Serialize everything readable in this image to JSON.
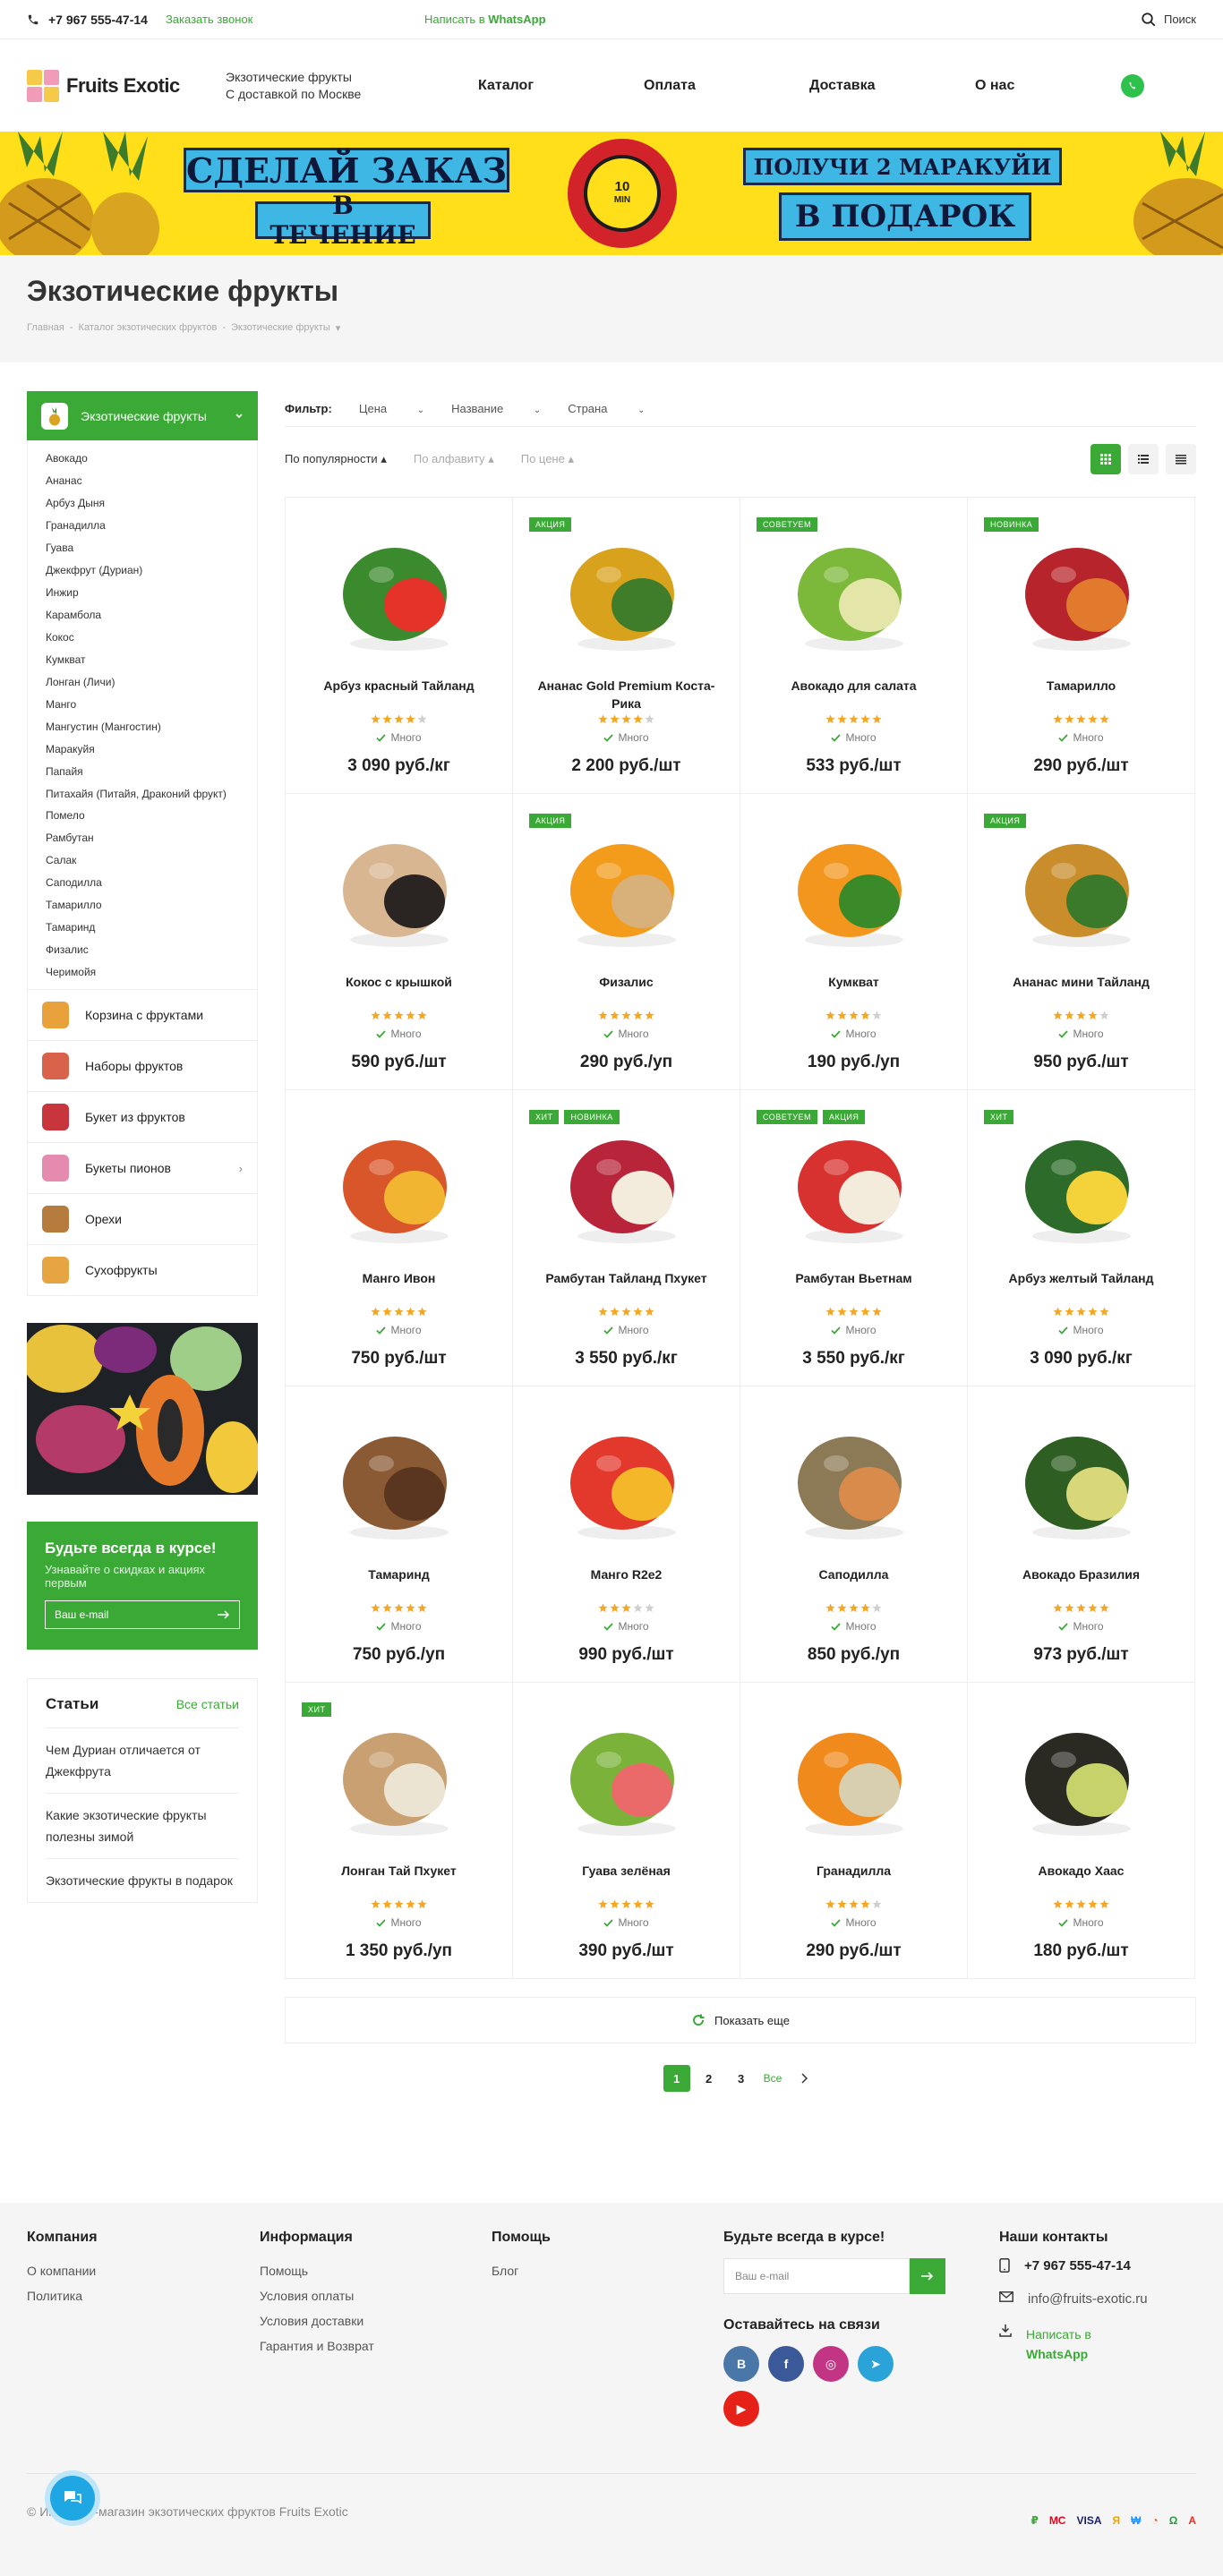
{
  "topbar": {
    "phone": "+7 967 555-47-14",
    "callback": "Заказать звонок",
    "whatsapp_prefix": "Написать в",
    "whatsapp_name": "WhatsApp",
    "search": "Поиск"
  },
  "header": {
    "logo_text": "Fruits Exotic",
    "tagline_1": "Экзотические фрукты",
    "tagline_2": "С доставкой по Москве",
    "nav": [
      "Каталог",
      "Оплата",
      "Доставка",
      "О нас"
    ]
  },
  "banner": {
    "left_top": "СДЕЛАЙ ЗАКАЗ",
    "left_bottom": "В ТЕЧЕНИЕ",
    "clock_num": "10",
    "clock_unit": "MIN",
    "right_top": "ПОЛУЧИ 2 МАРАКУЙИ",
    "right_bottom": "В ПОДАРОК"
  },
  "page": {
    "title": "Экзотические фрукты",
    "breadcrumb": [
      "Главная",
      "Каталог экзотических фруктов",
      "Экзотические фрукты"
    ]
  },
  "sidebar": {
    "main_category": "Экзотические фрукты",
    "subitems": [
      "Авокадо",
      "Ананас",
      "Арбуз Дыня",
      "Гранадилла",
      "Гуава",
      "Джекфрут (Дуриан)",
      "Инжир",
      "Карамбола",
      "Кокос",
      "Кумкват",
      "Лонган (Личи)",
      "Манго",
      "Мангустин (Мангостин)",
      "Маракуйя",
      "Папайя",
      "Питахайя (Питайя, Драконий фрукт)",
      "Помело",
      "Рамбутан",
      "Салак",
      "Саподилла",
      "Тамарилло",
      "Тамаринд",
      "Физалис",
      "Черимойя"
    ],
    "categories": [
      {
        "label": "Корзина с фруктами",
        "color": "#e9a23b"
      },
      {
        "label": "Наборы фруктов",
        "color": "#d9634a"
      },
      {
        "label": "Букет из фруктов",
        "color": "#c8353c"
      },
      {
        "label": "Букеты пионов",
        "color": "#e58bb0"
      },
      {
        "label": "Орехи",
        "color": "#b67c3d"
      },
      {
        "label": "Сухофрукты",
        "color": "#e7a443"
      }
    ],
    "subscribe": {
      "title": "Будьте всегда в курсе!",
      "text": "Узнавайте о скидках и акциях первым",
      "placeholder": "Ваш e-mail"
    },
    "articles": {
      "title": "Статьи",
      "all": "Все статьи",
      "items": [
        "Чем Дуриан отличается от Джекфрута",
        "Какие экзотические фрукты полезны зимой",
        "Экзотические фрукты в подарок"
      ]
    }
  },
  "filters": {
    "label": "Фильтр:",
    "items": [
      "Цена",
      "Название",
      "Страна"
    ]
  },
  "sort": {
    "items": [
      "По популярности",
      "По алфавиту",
      "По цене"
    ]
  },
  "availability_text": "Много",
  "products": [
    {
      "name": "Арбуз красный Тайланд",
      "price": "3 090 руб./кг",
      "rating": 4,
      "badges": [],
      "color1": "#3c8a2e",
      "color2": "#e5332a"
    },
    {
      "name": "Ананас Gold Premium Коста-Рика",
      "price": "2 200 руб./шт",
      "rating": 4,
      "badges": [
        "АКЦИЯ"
      ],
      "color1": "#d9a21d",
      "color2": "#3f7d2a"
    },
    {
      "name": "Авокадо для салата",
      "price": "533 руб./шт",
      "rating": 5,
      "badges": [
        "СОВЕТУЕМ"
      ],
      "color1": "#7cb83a",
      "color2": "#e3e6a8"
    },
    {
      "name": "Тамарилло",
      "price": "290 руб./шт",
      "rating": 5,
      "badges": [
        "НОВИНКА"
      ],
      "color1": "#b8242c",
      "color2": "#e27a2d"
    },
    {
      "name": "Кокос с крышкой",
      "price": "590 руб./шт",
      "rating": 5,
      "badges": [],
      "color1": "#d9b692",
      "color2": "#2a2522"
    },
    {
      "name": "Физалис",
      "price": "290 руб./уп",
      "rating": 5,
      "badges": [
        "АКЦИЯ"
      ],
      "color1": "#f39c1c",
      "color2": "#d7b07a"
    },
    {
      "name": "Кумкват",
      "price": "190 руб./уп",
      "rating": 4,
      "badges": [],
      "color1": "#f3961e",
      "color2": "#3b8a2a"
    },
    {
      "name": "Ананас мини Тайланд",
      "price": "950 руб./шт",
      "rating": 4,
      "badges": [
        "АКЦИЯ"
      ],
      "color1": "#c98d2c",
      "color2": "#3a7a2a"
    },
    {
      "name": "Манго Ивон",
      "price": "750 руб./шт",
      "rating": 5,
      "badges": [],
      "color1": "#d8562a",
      "color2": "#f1b532"
    },
    {
      "name": "Рамбутан Тайланд Пхукет",
      "price": "3 550 руб./кг",
      "rating": 5,
      "badges": [
        "ХИТ",
        "НОВИНКА"
      ],
      "color1": "#b8243a",
      "color2": "#f3ecdc"
    },
    {
      "name": "Рамбутан Вьетнам",
      "price": "3 550 руб./кг",
      "rating": 5,
      "badges": [
        "СОВЕТУЕМ",
        "АКЦИЯ"
      ],
      "color1": "#d7322f",
      "color2": "#f3ecdc"
    },
    {
      "name": "Арбуз желтый Тайланд",
      "price": "3 090 руб./кг",
      "rating": 5,
      "badges": [
        "ХИТ"
      ],
      "color1": "#2d6b2a",
      "color2": "#f4d23a"
    },
    {
      "name": "Тамаринд",
      "price": "750 руб./уп",
      "rating": 5,
      "badges": [],
      "color1": "#8a5a35",
      "color2": "#5a3520"
    },
    {
      "name": "Манго R2e2",
      "price": "990 руб./шт",
      "rating": 3,
      "badges": [],
      "color1": "#e3392c",
      "color2": "#f5b72a"
    },
    {
      "name": "Саподилла",
      "price": "850 руб./уп",
      "rating": 4,
      "badges": [],
      "color1": "#8c7a56",
      "color2": "#d88b4a"
    },
    {
      "name": "Авокадо Бразилия",
      "price": "973 руб./шт",
      "rating": 5,
      "badges": [],
      "color1": "#2f5e22",
      "color2": "#d8d77a"
    },
    {
      "name": "Лонган Тай Пхукет",
      "price": "1 350 руб./уп",
      "rating": 5,
      "badges": [
        "ХИТ"
      ],
      "color1": "#c9a072",
      "color2": "#ece4d2"
    },
    {
      "name": "Гуава зелёная",
      "price": "390 руб./шт",
      "rating": 5,
      "badges": [],
      "color1": "#7bb33a",
      "color2": "#ea6a6a"
    },
    {
      "name": "Гранадилла",
      "price": "290 руб./шт",
      "rating": 4,
      "badges": [],
      "color1": "#f08a1c",
      "color2": "#d8cfb0"
    },
    {
      "name": "Авокадо Хаас",
      "price": "180 руб./шт",
      "rating": 5,
      "badges": [],
      "color1": "#2b2a22",
      "color2": "#c7d36a"
    }
  ],
  "load_more": "Показать еще",
  "pagination": {
    "pages": [
      "1",
      "2",
      "3"
    ],
    "all": "Все"
  },
  "footer": {
    "company": {
      "title": "Компания",
      "links": [
        "О компании",
        "Политика"
      ]
    },
    "info": {
      "title": "Информация",
      "links": [
        "Помощь",
        "Условия оплаты",
        "Условия доставки",
        "Гарантия и Возврат"
      ]
    },
    "help": {
      "title": "Помощь",
      "links": [
        "Блог"
      ]
    },
    "subscribe_title": "Будьте всегда в курсе!",
    "subscribe_placeholder": "Ваш e-mail",
    "social_title": "Оставайтесь на связи",
    "social": [
      {
        "name": "vk",
        "label": "В",
        "color": "#4a76a8"
      },
      {
        "name": "facebook",
        "label": "f",
        "color": "#3b5998"
      },
      {
        "name": "instagram",
        "label": "◎",
        "color": "#c13584"
      },
      {
        "name": "telegram",
        "label": "➤",
        "color": "#2aa3d8"
      },
      {
        "name": "youtube",
        "label": "▶",
        "color": "#e62117"
      }
    ],
    "contacts_title": "Наши контакты",
    "contact_phone": "+7 967 555-47-14",
    "contact_email": "info@fruits-exotic.ru",
    "contact_wa_1": "Написать в",
    "contact_wa_2": "WhatsApp",
    "copyright": "© Интернет-магазин экзотических фруктов Fruits Exotic",
    "payments": [
      "₽",
      "MC",
      "VISA",
      "Я",
      "₩",
      "◔",
      "Ω",
      "A"
    ]
  }
}
